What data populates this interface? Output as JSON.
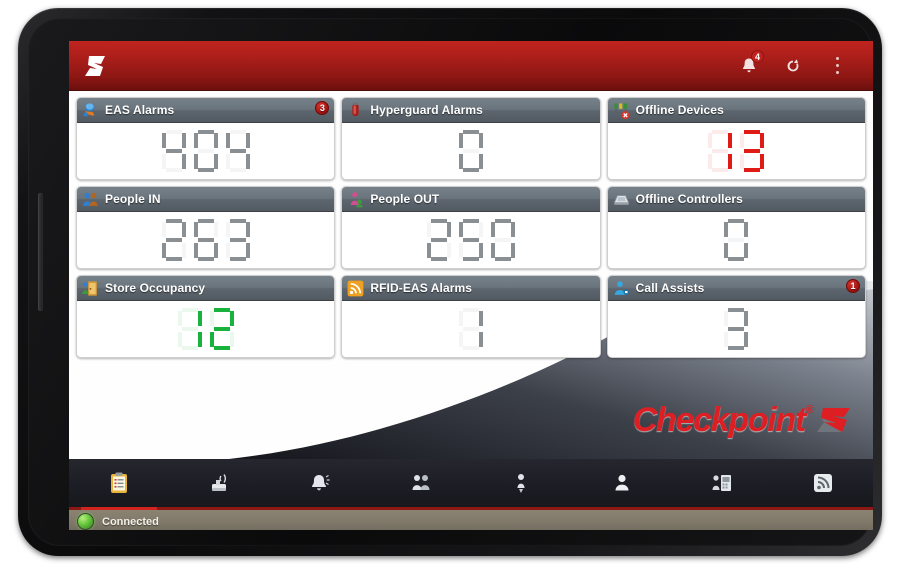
{
  "appbar": {
    "logo_icon": "checkpoint-logo-icon",
    "notifications_icon": "bell-icon",
    "notifications_badge": "4",
    "refresh_icon": "refresh-icon",
    "overflow_icon": "kebab-menu-icon"
  },
  "tiles": [
    {
      "id": "eas-alarms",
      "title": "EAS Alarms",
      "value": "404",
      "badge": "3",
      "value_color": "#8a8f94",
      "icon": "eas-pedestal-icon"
    },
    {
      "id": "hyperguard-alarms",
      "title": "Hyperguard Alarms",
      "value": "0",
      "badge": "",
      "value_color": "#8a8f94",
      "icon": "hyperguard-tag-icon"
    },
    {
      "id": "offline-devices",
      "title": "Offline Devices",
      "value": "13",
      "badge": "",
      "value_color": "#e01b16",
      "icon": "offline-device-icon"
    },
    {
      "id": "people-in",
      "title": "People IN",
      "value": "263",
      "badge": "",
      "value_color": "#8a8f94",
      "icon": "people-in-icon"
    },
    {
      "id": "people-out",
      "title": "People OUT",
      "value": "250",
      "badge": "",
      "value_color": "#8a8f94",
      "icon": "people-out-icon"
    },
    {
      "id": "offline-controllers",
      "title": "Offline Controllers",
      "value": "0",
      "badge": "",
      "value_color": "#8a8f94",
      "icon": "offline-controller-icon"
    },
    {
      "id": "store-occupancy",
      "title": "Store Occupancy",
      "value": "12",
      "badge": "",
      "value_color": "#19b23c",
      "icon": "store-occupancy-icon"
    },
    {
      "id": "rfid-eas-alarms",
      "title": "RFID-EAS Alarms",
      "value": "1",
      "badge": "",
      "value_color": "#8a8f94",
      "icon": "rfid-signal-icon"
    },
    {
      "id": "call-assists",
      "title": "Call Assists",
      "value": "3",
      "badge": "1",
      "value_color": "#8a8f94",
      "icon": "call-assist-person-icon"
    }
  ],
  "brand": {
    "word": "Checkpoint",
    "registered": "®",
    "mark_icon": "checkpoint-parallelogram-mark"
  },
  "tabs": [
    {
      "id": "dashboard",
      "icon": "clipboard-icon",
      "active": true
    },
    {
      "id": "devices",
      "icon": "antenna-pedestal-icon",
      "active": false
    },
    {
      "id": "alarms",
      "icon": "alarm-bell-icon",
      "active": false
    },
    {
      "id": "people",
      "icon": "people-group-icon",
      "active": false
    },
    {
      "id": "occupancy",
      "icon": "person-pin-icon",
      "active": false
    },
    {
      "id": "assists",
      "icon": "person-silhouette-icon",
      "active": false
    },
    {
      "id": "controllers",
      "icon": "controller-panel-icon",
      "active": false
    },
    {
      "id": "rfid",
      "icon": "rfid-feed-icon",
      "active": false
    }
  ],
  "status": {
    "led_icon": "connection-status-led",
    "text": "Connected",
    "led_color": "#62c23a"
  }
}
